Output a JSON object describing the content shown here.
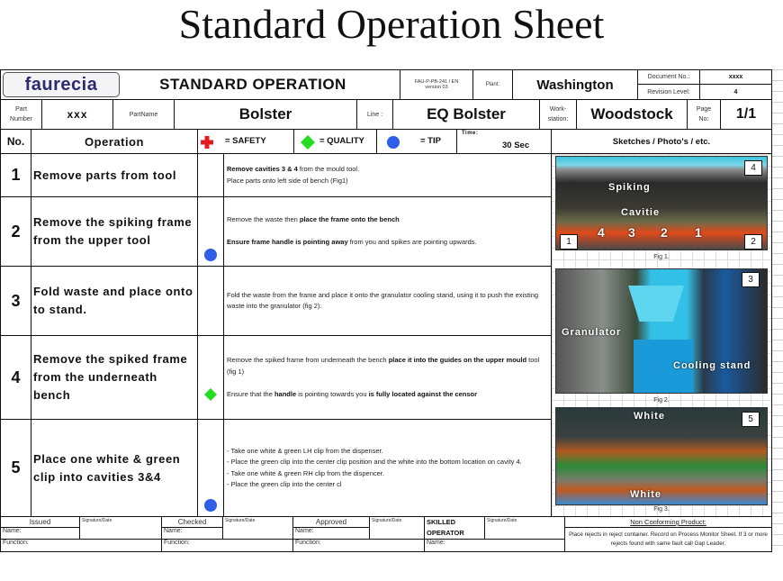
{
  "page_title": "Standard Operation Sheet",
  "header": {
    "logo": "faurecia",
    "title": "STANDARD OPERATION",
    "form_ref_line1": "FAU-P-PB-241 / EN",
    "form_ref_line2": "version 03",
    "plant_label": "Plant:",
    "plant_value": "Washington",
    "document_no_label": "Document No.:",
    "document_no_value": "xxxx",
    "revision_label": "Revision Level:",
    "revision_value": "4",
    "part_number_label_1": "Part",
    "part_number_label_2": "Number",
    "part_number_value": "xxx",
    "part_name_label": "PartName",
    "part_name_value": "Bolster",
    "line_label": "Line :",
    "line_value": "EQ Bolster",
    "workstation_label_1": "Work-",
    "workstation_label_2": "station:",
    "workstation_value": "Woodstock",
    "page_label_1": "Page",
    "page_label_2": "No:",
    "page_value": "1/1"
  },
  "columns": {
    "no": "No.",
    "operation": "Operation",
    "safety": "= SAFETY",
    "quality": "= QUALITY",
    "tip": "= TIP",
    "time_label": "Time:",
    "time_value": "30 Sec",
    "sketches": "Sketches / Photo's / etc."
  },
  "legend_colors": {
    "safety": "#e31b23",
    "quality": "#22dd22",
    "tip": "#2f5fe8"
  },
  "steps": [
    {
      "no": "1",
      "operation": "Remove parts from tool",
      "symbol": "none",
      "lines": [
        [
          {
            "t": "Remove cavities 3 & 4",
            "b": true
          },
          {
            "t": " from the mould tool.",
            "b": false
          }
        ],
        [
          {
            "t": "Place parts onto left side of bench (Fig1)",
            "b": false
          }
        ]
      ]
    },
    {
      "no": "2",
      "operation": "Remove the spiking frame from the upper tool",
      "symbol": "tip",
      "lines": [
        [
          {
            "t": "Remove the waste then ",
            "b": false
          },
          {
            "t": "place the frame onto the bench",
            "b": true
          }
        ],
        [
          {
            "t": "",
            "b": false
          }
        ],
        [
          {
            "t": "Ensure frame handle is pointing away",
            "b": true
          },
          {
            "t": " from you and spikes are pointing upwards.",
            "b": false
          }
        ]
      ]
    },
    {
      "no": "3",
      "operation": "Fold waste and place onto to stand.",
      "symbol": "none",
      "lines": [
        [
          {
            "t": "Fold the waste from the frame and place it onto the granulator cooling stand, using it to push the existing",
            "b": false
          }
        ],
        [
          {
            "t": "waste into the granulator (fig 2).",
            "b": false
          }
        ]
      ]
    },
    {
      "no": "4",
      "operation": "Remove the spiked frame from the underneath  bench",
      "symbol": "quality",
      "lines": [
        [
          {
            "t": "Remove the spiked frame from underneath the bench ",
            "b": false
          },
          {
            "t": "place it into the guides on the upper mould",
            "b": true
          },
          {
            "t": " tool (fig 1)",
            "b": false
          }
        ],
        [
          {
            "t": "",
            "b": false
          }
        ],
        [
          {
            "t": "Ensure that the ",
            "b": false
          },
          {
            "t": "handle",
            "b": true
          },
          {
            "t": " is pointing towards you ",
            "b": false
          },
          {
            "t": "is fully located against the censor",
            "b": true
          }
        ]
      ]
    },
    {
      "no": "5",
      "operation": "Place one white & green clip into cavities 3&4",
      "symbol": "tip",
      "lines": [
        [
          {
            "t": "- Take one white & green LH clip from the dispenser.",
            "b": false
          }
        ],
        [
          {
            "t": "-  Place the green clip into the center clip position and the white into the bottom location on cavity 4.",
            "b": false
          }
        ],
        [
          {
            "t": "-  Take one white & green RH clip from the dispencer.",
            "b": false
          }
        ],
        [
          {
            "t": "-  Place the green clip into the center cl",
            "b": false
          }
        ]
      ]
    }
  ],
  "figures": [
    {
      "caption": "Fig 1.",
      "labels": [
        "Spiking",
        "Cavitie"
      ],
      "cavity_numbers": [
        "4",
        "3",
        "2",
        "1"
      ],
      "markers": [
        "4",
        "1",
        "2"
      ]
    },
    {
      "caption": "Fig 2.",
      "labels": [
        "Granulator",
        "Cooling stand"
      ],
      "markers": [
        "3"
      ]
    },
    {
      "caption": "Fig 3.",
      "labels": [
        "White",
        "White"
      ],
      "markers": [
        "5"
      ]
    }
  ],
  "footer": {
    "issued": "Issued",
    "checked": "Checked",
    "approved": "Approved",
    "skilled_1": "SKILLED",
    "skilled_2": "OPERATOR",
    "signature_date": "Signature/Date",
    "name": "Name:",
    "function": "Function:",
    "ncp_title": "Non Conforming Product:",
    "ncp_text": "Place rejects in reject container. Record on Process Monitor Sheet. If 3 or more rejects found with same fault call Gap Leader."
  }
}
